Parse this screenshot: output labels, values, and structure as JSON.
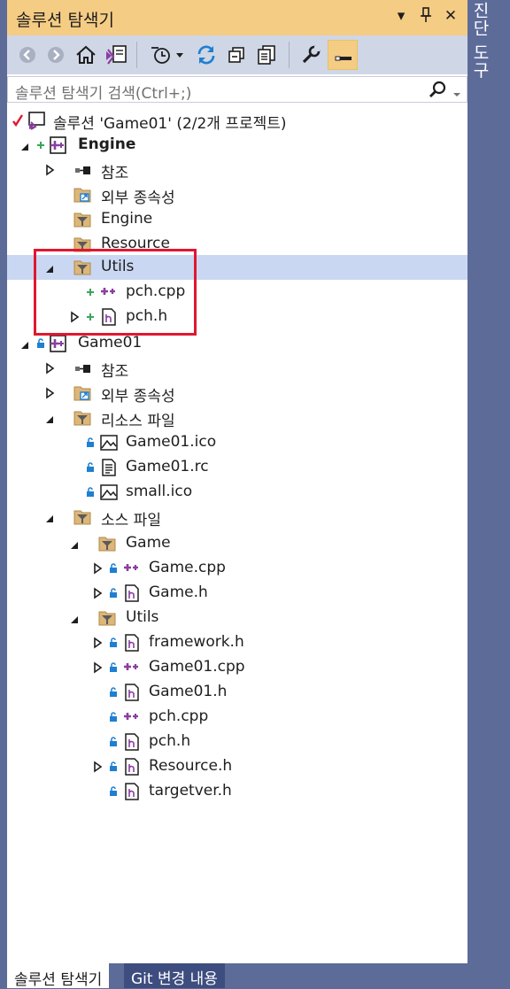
{
  "window": {
    "title": "솔루션 탐색기",
    "title_buttons": [
      "▾",
      "⊥",
      "✕"
    ]
  },
  "side_tab": {
    "label": "진단 도구"
  },
  "toolbar": {
    "buttons": [
      "back-icon",
      "forward-icon",
      "home-icon",
      "switch-views-icon",
      "pending-changes-filter-icon",
      "sync-icon",
      "collapse-all-icon",
      "show-all-files-icon",
      "properties-icon",
      "preview-icon"
    ]
  },
  "search": {
    "placeholder": "솔루션 탐색기 검색(Ctrl+;)"
  },
  "tree": {
    "solution": "솔루션 'Game01' (2/2개 프로젝트)",
    "engine": {
      "label": "Engine",
      "references": "참조",
      "external": "외부 종속성",
      "engine_folder": "Engine",
      "resource_folder": "Resource",
      "utils_folder": "Utils",
      "pch_cpp": "pch.cpp",
      "pch_h": "pch.h"
    },
    "game01": {
      "label": "Game01",
      "references": "참조",
      "external": "외부 종속성",
      "resource_files": "리소스 파일",
      "game01_ico": "Game01.ico",
      "game01_rc": "Game01.rc",
      "small_ico": "small.ico",
      "source_files": "소스 파일",
      "game_folder": "Game",
      "game_cpp": "Game.cpp",
      "game_h": "Game.h",
      "utils_folder": "Utils",
      "framework_h": "framework.h",
      "game01_cpp": "Game01.cpp",
      "game01_h": "Game01.h",
      "pch_cpp": "pch.cpp",
      "pch_h": "pch.h",
      "resource_h": "Resource.h",
      "targetver_h": "targetver.h"
    }
  },
  "bottom_tabs": {
    "active": "솔루션 탐색기",
    "inactive": "Git 변경 내용"
  },
  "colors": {
    "title_bg": "#f5cc84",
    "toolbar_bg": "#cfd6e5",
    "frame_bg": "#5d6b99",
    "selection_bg": "#c9d7f2",
    "highlight_border": "#e0172f",
    "cpp_icon": "#8a3fa0",
    "lock_icon": "#1f7fd1",
    "added_icon": "#3aa55c"
  }
}
